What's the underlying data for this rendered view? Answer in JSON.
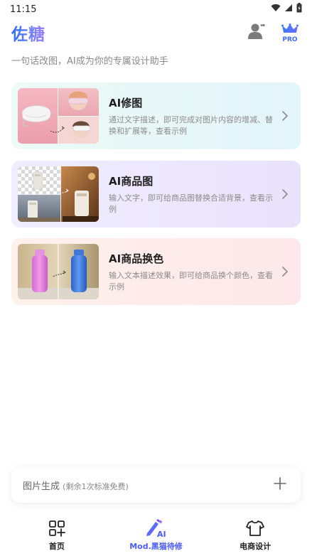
{
  "status_bar": {
    "time": "11:15"
  },
  "header": {
    "app_title": "佐糖",
    "pro_badge": "PRO",
    "icons": [
      "account-icon",
      "crown-pro-icon"
    ]
  },
  "subtitle": "一句话改图，AI成为你的专属设计助手",
  "cards": [
    {
      "title": "AI修图",
      "desc": "通过文字描述，即可完成对图片内容的增减、替换和扩展等，查看示例",
      "accent": "#e3f4fb"
    },
    {
      "title": "AI商品图",
      "desc": "输入文字，即可给商品图替换合适背景，查看示例",
      "accent": "#e9e2fb"
    },
    {
      "title": "AI商品换色",
      "desc": "输入文本描述效果，即可给商品换个颜色，查看示例",
      "accent": "#fde7ea"
    }
  ],
  "generate_bar": {
    "label": "图片生成",
    "quota": "(剩余1次标准免费)"
  },
  "tabs": [
    {
      "label": "首页",
      "icon": "home-grid-icon",
      "active": false
    },
    {
      "label": "Mod.黑猫待修",
      "icon": "ai-pen-icon",
      "active": true
    },
    {
      "label": "电商设计",
      "icon": "tshirt-icon",
      "active": false
    }
  ],
  "colors": {
    "brand_blue": "#4a5cff",
    "title_gradient_start": "#2f6bff",
    "title_gradient_end": "#9a7cff"
  }
}
